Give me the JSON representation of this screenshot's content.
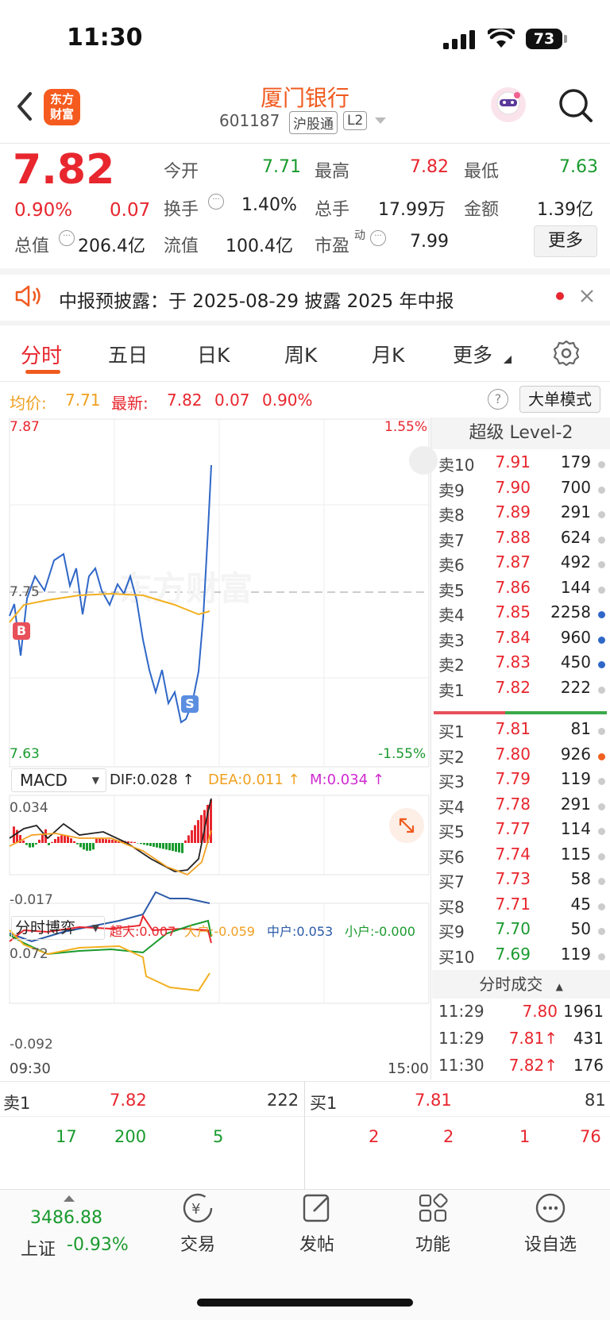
{
  "status_bar": {
    "time": "11:30",
    "battery": "73"
  },
  "header": {
    "title": "厦门银行",
    "code": "601187",
    "tag1": "沪股通",
    "tag2": "L2",
    "logo": "东方财富"
  },
  "quote": {
    "price": "7.82",
    "pct": "0.90%",
    "chg": "0.07",
    "open_label": "今开",
    "open": "7.71",
    "high_label": "最高",
    "high": "7.82",
    "low_label": "最低",
    "low": "7.63",
    "turnover_label": "换手",
    "turnover": "1.40%",
    "volume_label": "总手",
    "volume": "17.99万",
    "amount_label": "金额",
    "amount": "1.39亿",
    "mcap_label": "总值",
    "mcap": "206.4亿",
    "float_label": "流值",
    "float": "100.4亿",
    "pe_label": "市盈",
    "pe_sup": "动",
    "pe": "7.99",
    "more": "更多"
  },
  "notice": {
    "text": "中报预披露：于 2025-08-29 披露 2025 年中报"
  },
  "tabs": [
    "分时",
    "五日",
    "日K",
    "周K",
    "月K",
    "更多"
  ],
  "info_bar": {
    "avg_label": "均价:",
    "avg": "7.71",
    "latest_label": "最新:",
    "latest": "7.82",
    "chg": "0.07",
    "pct": "0.90%",
    "help": "?",
    "mode": "大单模式"
  },
  "chart": {
    "ymax": "7.87",
    "ymid": "7.75",
    "ymin": "7.63",
    "pmax": "1.55%",
    "pmin": "-1.55%",
    "watermark": "东方财富",
    "time_start": "09:30",
    "time_end": "15:00",
    "marker_b": "B",
    "marker_s": "S"
  },
  "macd": {
    "name": "MACD",
    "dif": "DIF:0.028 ↑",
    "dea": "DEA:0.011 ↑",
    "m": "M:0.034 ↑",
    "ymax": "0.034",
    "ymin": "-0.017"
  },
  "game": {
    "name": "分时博弈",
    "super": "超大:0.007",
    "big": "大户:-0.059",
    "mid": "中户:0.053",
    "small": "小户:-0.000",
    "ymax": "0.072",
    "ymin": "-0.092"
  },
  "orderbook": {
    "title": "超级 Level-2",
    "asks": [
      {
        "label": "卖10",
        "price": "7.91",
        "vol": "179"
      },
      {
        "label": "卖9",
        "price": "7.90",
        "vol": "700"
      },
      {
        "label": "卖8",
        "price": "7.89",
        "vol": "291"
      },
      {
        "label": "卖7",
        "price": "7.88",
        "vol": "624"
      },
      {
        "label": "卖6",
        "price": "7.87",
        "vol": "492"
      },
      {
        "label": "卖5",
        "price": "7.86",
        "vol": "144"
      },
      {
        "label": "卖4",
        "price": "7.85",
        "vol": "2258"
      },
      {
        "label": "卖3",
        "price": "7.84",
        "vol": "960"
      },
      {
        "label": "卖2",
        "price": "7.83",
        "vol": "450"
      },
      {
        "label": "卖1",
        "price": "7.82",
        "vol": "222"
      }
    ],
    "bids": [
      {
        "label": "买1",
        "price": "7.81",
        "vol": "81"
      },
      {
        "label": "买2",
        "price": "7.80",
        "vol": "926"
      },
      {
        "label": "买3",
        "price": "7.79",
        "vol": "119"
      },
      {
        "label": "买4",
        "price": "7.78",
        "vol": "291"
      },
      {
        "label": "买5",
        "price": "7.77",
        "vol": "114"
      },
      {
        "label": "买6",
        "price": "7.74",
        "vol": "115"
      },
      {
        "label": "买7",
        "price": "7.73",
        "vol": "58"
      },
      {
        "label": "买8",
        "price": "7.71",
        "vol": "45"
      },
      {
        "label": "买9",
        "price": "7.70",
        "vol": "50"
      },
      {
        "label": "买10",
        "price": "7.69",
        "vol": "119"
      }
    ],
    "ticks_title": "分时成交",
    "ticks": [
      {
        "time": "11:29",
        "price": "7.80",
        "vol": "1961"
      },
      {
        "time": "11:29",
        "price": "7.81↑",
        "vol": "431"
      },
      {
        "time": "11:30",
        "price": "7.82↑",
        "vol": "176"
      }
    ]
  },
  "queue": {
    "sell_label": "卖1",
    "sell_price": "7.82",
    "sell_vol": "222",
    "buy_label": "买1",
    "buy_price": "7.81",
    "buy_vol": "81",
    "sell_orders": [
      "17",
      "200",
      "5"
    ],
    "buy_orders": [
      "2",
      "2",
      "1",
      "76"
    ]
  },
  "bottom_nav": {
    "index_value": "3486.88",
    "index_name": "上证",
    "index_pct": "-0.93%",
    "trade": "交易",
    "post": "发帖",
    "func": "功能",
    "watch": "设自选"
  }
}
